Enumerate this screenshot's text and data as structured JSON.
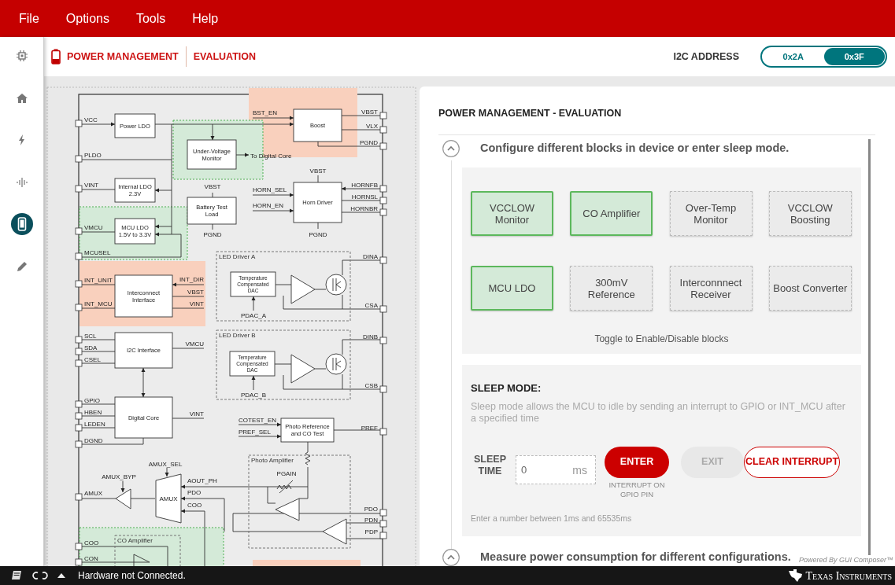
{
  "menu": [
    "File",
    "Options",
    "Tools",
    "Help"
  ],
  "sidebar": {
    "items": [
      {
        "kind": "chip",
        "selected": false
      },
      {
        "kind": "home",
        "selected": false
      },
      {
        "kind": "bolt",
        "selected": false
      },
      {
        "kind": "wave",
        "selected": false
      },
      {
        "kind": "phone",
        "selected": true
      },
      {
        "kind": "pencil",
        "selected": false
      }
    ]
  },
  "breadcrumb": [
    "POWER MANAGEMENT",
    "EVALUATION"
  ],
  "i2c_address": {
    "label": "I2C ADDRESS",
    "options": [
      {
        "label": "0x2A",
        "selected": false
      },
      {
        "label": "0x3F",
        "selected": true
      }
    ]
  },
  "diagram": {
    "regions": [
      {
        "enabled": false
      },
      {
        "enabled": true
      },
      {
        "enabled": true
      },
      {
        "enabled": false
      },
      {
        "enabled": true
      },
      {
        "enabled": false
      }
    ],
    "pins_left": [
      "VCC",
      "PLDO",
      "VINT",
      "VMCU",
      "MCUSEL",
      "INT_UNIT",
      "INT_MCU",
      "SCL",
      "SDA",
      "CSEL",
      "GPIO",
      "HBEN",
      "LEDEN",
      "DGND",
      "AMUX",
      "COO",
      "CON"
    ],
    "pins_right": [
      "VBST",
      "VLX",
      "PGND",
      "HORNFB",
      "HORNSL",
      "HORNBR",
      "DINA",
      "CSA",
      "DINB",
      "CSB",
      "PREF",
      "PDO",
      "PDN",
      "PDP"
    ],
    "blocks": [
      {
        "lines": [
          "Power LDO"
        ]
      },
      {
        "lines": [
          "Boost"
        ]
      },
      {
        "lines": [
          "Under-Voltage",
          "Monitor"
        ]
      },
      {
        "lines": [
          "Internal LDO",
          "2.3V"
        ]
      },
      {
        "lines": [
          "Battery Test",
          "Load"
        ]
      },
      {
        "lines": [
          "Horn Driver"
        ]
      },
      {
        "lines": [
          "MCU LDO",
          "1.5V to 3.3V"
        ]
      },
      {
        "lines": [
          "Interconnect",
          "Interface"
        ]
      },
      {
        "lines": [
          "Temperature",
          "Compensated",
          "DAC"
        ]
      },
      {
        "lines": [
          "I2C Interface"
        ]
      },
      {
        "lines": [
          "Temperature",
          "Compensated",
          "DAC"
        ]
      },
      {
        "lines": [
          "Digital Core"
        ]
      },
      {
        "lines": [
          "Photo Reference",
          "and CO Test"
        ]
      }
    ],
    "groups": [
      "LED Driver A",
      "LED Driver B",
      "Photo Amplifier",
      "CO Amplifier"
    ],
    "signals": [
      "BST_EN",
      "To Digital Core",
      "VBST",
      "PGND",
      "VBST",
      "HORN_SEL",
      "HORN_EN",
      "PGND",
      "INT_DIR",
      "VBST",
      "VINT",
      "PDAC_A",
      "VMCU",
      "PDAC_B",
      "VINT",
      "COTEST_EN",
      "PREF_SEL",
      "AMUX_SEL",
      "AMUX_BYP",
      "AOUT_PH",
      "PDO",
      "COO",
      "PGAIN",
      "AMUX"
    ]
  },
  "panel": {
    "title": "POWER MANAGEMENT - EVALUATION",
    "sections": [
      "Configure different blocks in device or enter sleep mode.",
      "Measure power consumption for different configurations."
    ],
    "blocks": [
      {
        "label": "VCCLOW Monitor",
        "enabled": true
      },
      {
        "label": "CO Amplifier",
        "enabled": true
      },
      {
        "label": "Over-Temp Monitor",
        "enabled": false
      },
      {
        "label": "VCCLOW Boosting",
        "enabled": false
      },
      {
        "label": "MCU LDO",
        "enabled": true
      },
      {
        "label": "300mV Reference",
        "enabled": false
      },
      {
        "label": "Interconnnect Receiver",
        "enabled": false
      },
      {
        "label": "Boost Converter",
        "enabled": false
      }
    ],
    "toggle_hint": "Toggle to Enable/Disable blocks",
    "sleep": {
      "title": "SLEEP MODE:",
      "description": "Sleep mode allows the MCU to idle by sending an interrupt to GPIO or INT_MCU after a specified time",
      "time_label": "SLEEP TIME",
      "value": "0",
      "unit": "ms",
      "buttons": [
        {
          "label": "ENTER",
          "kind": "primary",
          "caption": "INTERRUPT ON GPIO PIN"
        },
        {
          "label": "EXIT",
          "kind": "disabled"
        },
        {
          "label": "CLEAR INTERRUPT",
          "kind": "outline"
        }
      ],
      "hint": "Enter a number between 1ms and 65535ms"
    },
    "footer_note": "Powered By GUI Composer™"
  },
  "status_bar": {
    "text": "Hardware not Connected.",
    "brand": "Texas Instruments"
  }
}
